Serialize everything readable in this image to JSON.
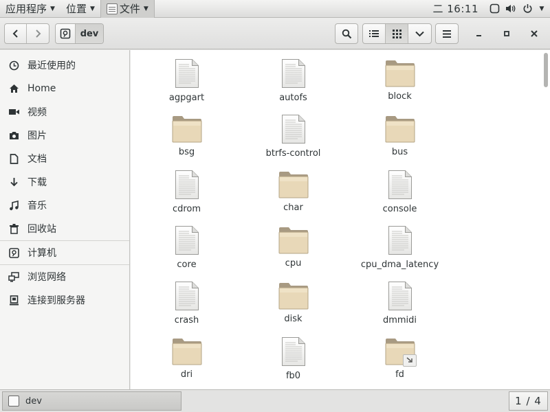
{
  "top_panel": {
    "applications": "应用程序",
    "places": "位置",
    "files_menu": "文件",
    "clock": "二 16:11",
    "icons": [
      "display-icon",
      "volume-icon",
      "power-icon"
    ]
  },
  "headerbar": {
    "path_label": "dev"
  },
  "sidebar": {
    "items": [
      {
        "label": "最近使用的",
        "icon": "clock-icon"
      },
      {
        "label": "Home",
        "icon": "home-icon"
      },
      {
        "label": "视频",
        "icon": "video-icon"
      },
      {
        "label": "图片",
        "icon": "camera-icon"
      },
      {
        "label": "文档",
        "icon": "document-icon"
      },
      {
        "label": "下载",
        "icon": "download-icon"
      },
      {
        "label": "音乐",
        "icon": "music-icon"
      },
      {
        "label": "回收站",
        "icon": "trash-icon"
      },
      {
        "label": "计算机",
        "icon": "drive-icon"
      },
      {
        "label": "浏览网络",
        "icon": "network-icon"
      },
      {
        "label": "连接到服务器",
        "icon": "server-icon"
      }
    ]
  },
  "files": [
    {
      "name": "agpgart",
      "type": "doc"
    },
    {
      "name": "autofs",
      "type": "doc"
    },
    {
      "name": "block",
      "type": "folder"
    },
    {
      "name": "bsg",
      "type": "folder"
    },
    {
      "name": "btrfs-control",
      "type": "doc"
    },
    {
      "name": "bus",
      "type": "folder"
    },
    {
      "name": "cdrom",
      "type": "doc"
    },
    {
      "name": "char",
      "type": "folder"
    },
    {
      "name": "console",
      "type": "doc"
    },
    {
      "name": "core",
      "type": "doc"
    },
    {
      "name": "cpu",
      "type": "folder"
    },
    {
      "name": "cpu_dma_latency",
      "type": "doc"
    },
    {
      "name": "crash",
      "type": "doc"
    },
    {
      "name": "disk",
      "type": "folder"
    },
    {
      "name": "dmmidi",
      "type": "doc"
    },
    {
      "name": "dri",
      "type": "folder"
    },
    {
      "name": "fb0",
      "type": "doc"
    },
    {
      "name": "fd",
      "type": "folder-link"
    }
  ],
  "statusbar": {
    "task_label": "dev",
    "pager": "1 / 4"
  },
  "colors": {
    "folder_body": "#e8d8b8",
    "folder_tab": "#a89a82",
    "folder_front": "#efe2c6"
  }
}
